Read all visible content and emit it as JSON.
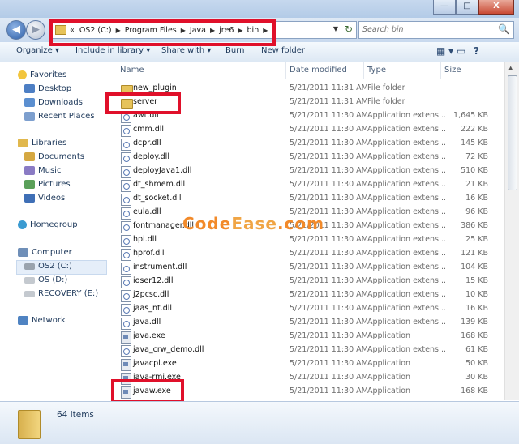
{
  "window": {
    "minimize": "—",
    "maximize": "□",
    "close": "X"
  },
  "address": {
    "overflow": "«",
    "crumbs": [
      "OS2 (C:)",
      "Program Files",
      "Java",
      "jre6",
      "bin"
    ],
    "separator": "▶",
    "dropdown": "▼",
    "refresh": "↻"
  },
  "search": {
    "placeholder": "Search bin",
    "icon": "🔍"
  },
  "toolbar": {
    "organize": "Organize ▾",
    "include": "Include in library ▾",
    "share": "Share with ▾",
    "burn": "Burn",
    "new_folder": "New folder",
    "views": "▦ ▾",
    "pane": "▭",
    "help": "?"
  },
  "nav": {
    "favorites": "Favorites",
    "desktop": "Desktop",
    "downloads": "Downloads",
    "recent": "Recent Places",
    "libraries": "Libraries",
    "documents": "Documents",
    "music": "Music",
    "pictures": "Pictures",
    "videos": "Videos",
    "homegroup": "Homegroup",
    "computer": "Computer",
    "drive_c": "OS2 (C:)",
    "drive_d": "OS (D:)",
    "drive_e": "RECOVERY (E:)",
    "network": "Network"
  },
  "columns": {
    "name": "Name",
    "date": "Date modified",
    "type": "Type",
    "size": "Size"
  },
  "files": [
    {
      "name": "new_plugin",
      "date": "5/21/2011 11:31 AM",
      "type": "File folder",
      "size": "",
      "kind": "folder"
    },
    {
      "name": "server",
      "date": "5/21/2011 11:31 AM",
      "type": "File folder",
      "size": "",
      "kind": "folder"
    },
    {
      "name": "awt.dll",
      "date": "5/21/2011 11:30 AM",
      "type": "Application extens...",
      "size": "1,645 KB",
      "kind": "dll"
    },
    {
      "name": "cmm.dll",
      "date": "5/21/2011 11:30 AM",
      "type": "Application extens...",
      "size": "222 KB",
      "kind": "dll"
    },
    {
      "name": "dcpr.dll",
      "date": "5/21/2011 11:30 AM",
      "type": "Application extens...",
      "size": "145 KB",
      "kind": "dll"
    },
    {
      "name": "deploy.dll",
      "date": "5/21/2011 11:30 AM",
      "type": "Application extens...",
      "size": "72 KB",
      "kind": "dll"
    },
    {
      "name": "deployJava1.dll",
      "date": "5/21/2011 11:30 AM",
      "type": "Application extens...",
      "size": "510 KB",
      "kind": "dll"
    },
    {
      "name": "dt_shmem.dll",
      "date": "5/21/2011 11:30 AM",
      "type": "Application extens...",
      "size": "21 KB",
      "kind": "dll"
    },
    {
      "name": "dt_socket.dll",
      "date": "5/21/2011 11:30 AM",
      "type": "Application extens...",
      "size": "16 KB",
      "kind": "dll"
    },
    {
      "name": "eula.dll",
      "date": "5/21/2011 11:30 AM",
      "type": "Application extens...",
      "size": "96 KB",
      "kind": "dll"
    },
    {
      "name": "fontmanager.dll",
      "date": "5/21/2011 11:30 AM",
      "type": "Application extens...",
      "size": "386 KB",
      "kind": "dll"
    },
    {
      "name": "hpi.dll",
      "date": "5/21/2011 11:30 AM",
      "type": "Application extens...",
      "size": "25 KB",
      "kind": "dll"
    },
    {
      "name": "hprof.dll",
      "date": "5/21/2011 11:30 AM",
      "type": "Application extens...",
      "size": "121 KB",
      "kind": "dll"
    },
    {
      "name": "instrument.dll",
      "date": "5/21/2011 11:30 AM",
      "type": "Application extens...",
      "size": "104 KB",
      "kind": "dll"
    },
    {
      "name": "ioser12.dll",
      "date": "5/21/2011 11:30 AM",
      "type": "Application extens...",
      "size": "15 KB",
      "kind": "dll"
    },
    {
      "name": "j2pcsc.dll",
      "date": "5/21/2011 11:30 AM",
      "type": "Application extens...",
      "size": "10 KB",
      "kind": "dll"
    },
    {
      "name": "jaas_nt.dll",
      "date": "5/21/2011 11:30 AM",
      "type": "Application extens...",
      "size": "16 KB",
      "kind": "dll"
    },
    {
      "name": "java.dll",
      "date": "5/21/2011 11:30 AM",
      "type": "Application extens...",
      "size": "139 KB",
      "kind": "dll"
    },
    {
      "name": "java.exe",
      "date": "5/21/2011 11:30 AM",
      "type": "Application",
      "size": "168 KB",
      "kind": "exe"
    },
    {
      "name": "java_crw_demo.dll",
      "date": "5/21/2011 11:30 AM",
      "type": "Application extens...",
      "size": "61 KB",
      "kind": "dll"
    },
    {
      "name": "javacpl.exe",
      "date": "5/21/2011 11:30 AM",
      "type": "Application",
      "size": "50 KB",
      "kind": "exe"
    },
    {
      "name": "java-rmi.exe",
      "date": "5/21/2011 11:30 AM",
      "type": "Application",
      "size": "30 KB",
      "kind": "exe"
    },
    {
      "name": "javaw.exe",
      "date": "5/21/2011 11:30 AM",
      "type": "Application",
      "size": "168 KB",
      "kind": "exe"
    }
  ],
  "status": {
    "items": "64 items"
  },
  "watermark": {
    "part1": "Code",
    "part2": "Ease",
    "part3": ".com"
  }
}
